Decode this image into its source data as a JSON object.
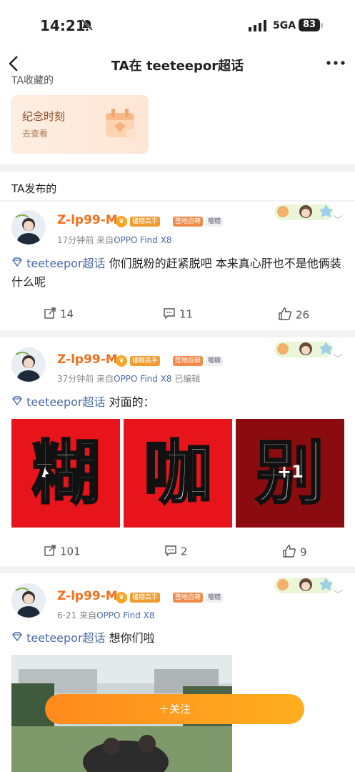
{
  "status": {
    "time": "14:21",
    "network": "5GA",
    "battery": "83"
  },
  "nav": {
    "title": "TA在 teeteepor超话"
  },
  "collected": {
    "header": "TA收藏的",
    "card_title": "纪念时刻",
    "card_sub": "去查看"
  },
  "posted": {
    "header": "TA发布的"
  },
  "posts": [
    {
      "username": "Z-lp99-M",
      "badge1": "磕糖高手",
      "badge2": "签地自萌",
      "badge3": "嗑糖",
      "time": "17分钟前",
      "from": "来自",
      "device": "OPPO Find X8",
      "edited": "",
      "topic": "teeteepor超话",
      "text": " 你们脱粉的赶紧脱吧 本来真心肝也不是他俩装什么呢",
      "repost": "14",
      "comment": "11",
      "like": "26"
    },
    {
      "username": "Z-lp99-M",
      "badge1": "磕糖高手",
      "badge2": "签地自萌",
      "badge3": "嗑糖",
      "time": "37分钟前",
      "from": "来自",
      "device": "OPPO Find X8",
      "edited": "已编辑",
      "topic": "teeteepor超话",
      "text": " 对面的：",
      "images": [
        "糊",
        "咖",
        "别"
      ],
      "image_overlay": "+1",
      "repost": "101",
      "comment": "2",
      "like": "9"
    },
    {
      "username": "Z-lp99-M",
      "badge1": "磕糖高手",
      "badge2": "签地自萌",
      "badge3": "嗑糖",
      "time": "6-21",
      "from": "来自",
      "device": "OPPO Find X8",
      "edited": "",
      "topic": "teeteepor超话",
      "text": " 想你们啦"
    }
  ],
  "follow": {
    "label": "＋关注"
  },
  "colors": {
    "accent": "#f0701d",
    "topic": "#4a6aa8",
    "follow": "#ff9a1c"
  }
}
